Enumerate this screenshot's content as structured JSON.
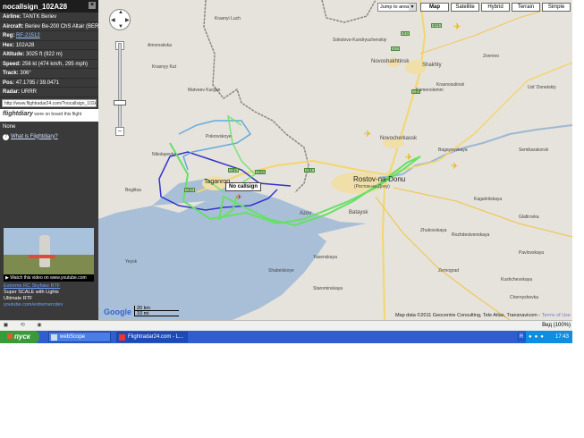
{
  "flight_panel": {
    "title": "nocallsign_102A28",
    "rows": [
      {
        "key": "Airline:",
        "value": "TANTK Beriev"
      },
      {
        "key": "Aircraft:",
        "value": "Beriev Be-200 ChS Altair (BER2)"
      },
      {
        "key": "Reg:",
        "value": "RF-21512"
      },
      {
        "key": "Hex:",
        "value": "102A28"
      },
      {
        "key": "Altitude:",
        "value": "3025 ft (922 m)"
      },
      {
        "key": "Speed:",
        "value": "256 kt (474 km/h, 295 mph)"
      },
      {
        "key": "Track:",
        "value": "306°"
      },
      {
        "key": "Pos:",
        "value": "47.1795 / 39.0471"
      },
      {
        "key": "Radar:",
        "value": "URRR"
      }
    ],
    "url": "http://www.flightradar24.com/?nocallsign_102A28",
    "flightdiary_logo": "flightdiary",
    "flightdiary_prompt": "were on board this flight",
    "none_text": "None",
    "what_link": "What is Flightdiary?",
    "video_caption": "Watch this video on www.youtube.com",
    "ad_title": "Extreme RC Skyfake RTF",
    "ad_line1": "Super SCALE with Lights",
    "ad_line2": "Ultimate RTF",
    "ad_url": "youtube.com/extremercdev"
  },
  "map": {
    "jump_to_area": "Jump to area",
    "map_types": [
      "Map",
      "Satellite",
      "Hybrid",
      "Terrain",
      "Simple"
    ],
    "active_map_type": "Map",
    "zoom_in": "+",
    "zoom_out": "−",
    "callsign_tag": "No callsign",
    "scale_km": "20 km",
    "scale_mi": "10 mi",
    "google_logo": "Google",
    "copyright": "Map data ©2011 Geocentre Consulting, Tele Atlas, Transnavicom -",
    "terms": "Terms of Use",
    "cities": [
      {
        "name": "Rostov-na-Donu",
        "sub": "(Ростов-на-Дону)"
      },
      {
        "name": "Taganrog"
      },
      {
        "name": "Novocherkassk"
      },
      {
        "name": "Shakhty"
      },
      {
        "name": "Novoshakhtinsk"
      },
      {
        "name": "Bataysk"
      },
      {
        "name": "Azov"
      }
    ],
    "small_labels": [
      "Amvrosiivka",
      "Krasnyi Luch",
      "Sokolovo-Kundryuchenskiy",
      "Krasnyy Kut",
      "Krasnosulinsk",
      "Zverevo",
      "Matveev Kurgan",
      "Pokrovskoye",
      "Nikolayevka",
      "Kamenolomni",
      "Ust' Donetskiy",
      "Bagayevskaya",
      "Semikarakorsk",
      "Kagalnitskaya",
      "Zernograd",
      "Yeysk",
      "Starominskaya",
      "Kushchevskaya",
      "Pavlovskaya",
      "Chernyshevka",
      "Zhukovskaya",
      "Glafirovka",
      "Shabelskoye",
      "Yasenskaya",
      "Beglitsa",
      "Rozhdestvenskaya"
    ],
    "road_labels": [
      "M-23",
      "M-4",
      "E58",
      "E40",
      "E115",
      "M-19",
      "M-21",
      "M-23"
    ]
  },
  "browser_status": {
    "zoom": "Вид (100%)"
  },
  "taskbar": {
    "start_label": "пуск",
    "tasks": [
      "webScope",
      "Flightradar24.com - L..."
    ],
    "clock": "17:43"
  },
  "colors": {
    "panel_bg": "#3a3a3a",
    "map_bg": "#e5e3dc",
    "sea": "#a9bfd8",
    "track_green": "#66e066",
    "track_blue": "#3333cc",
    "track_light": "#66aadd",
    "taskbar": "#2f5fcf",
    "start": "#3a9a3a"
  }
}
